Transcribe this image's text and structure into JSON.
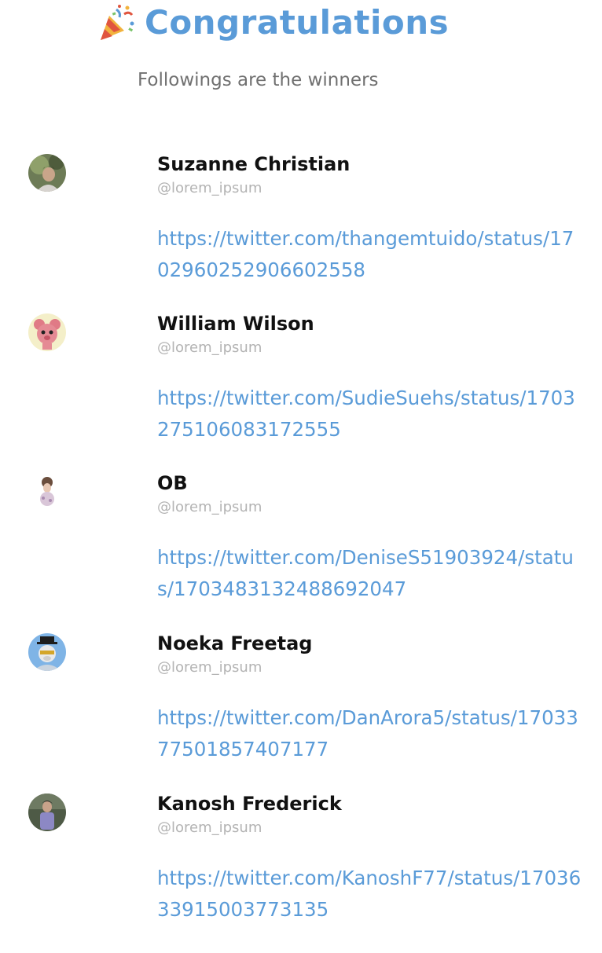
{
  "header": {
    "title": "Congratulations",
    "subtitle": "Followings are the winners",
    "icon": "party-popper-icon"
  },
  "colors": {
    "accent": "#5a9bd8",
    "name": "#111111",
    "handle": "#b3b3b3",
    "subtitle": "#707070"
  },
  "winners": [
    {
      "name": "Suzanne Christian",
      "handle": "@lorem_ipsum",
      "link": "https://twitter.com/thangemtuido/status/1702960252906602558"
    },
    {
      "name": "William Wilson",
      "handle": "@lorem_ipsum",
      "link": "https://twitter.com/SudieSuehs/status/1703275106083172555"
    },
    {
      "name": "OB",
      "handle": "@lorem_ipsum",
      "link": "https://twitter.com/DeniseS51903924/status/1703483132488692047"
    },
    {
      "name": "Noeka Freetag",
      "handle": "@lorem_ipsum",
      "link": "https://twitter.com/DanArora5/status/1703377501857407177"
    },
    {
      "name": "Kanosh Frederick",
      "handle": "@lorem_ipsum",
      "link": "https://twitter.com/KanoshF77/status/1703633915003773135"
    }
  ]
}
